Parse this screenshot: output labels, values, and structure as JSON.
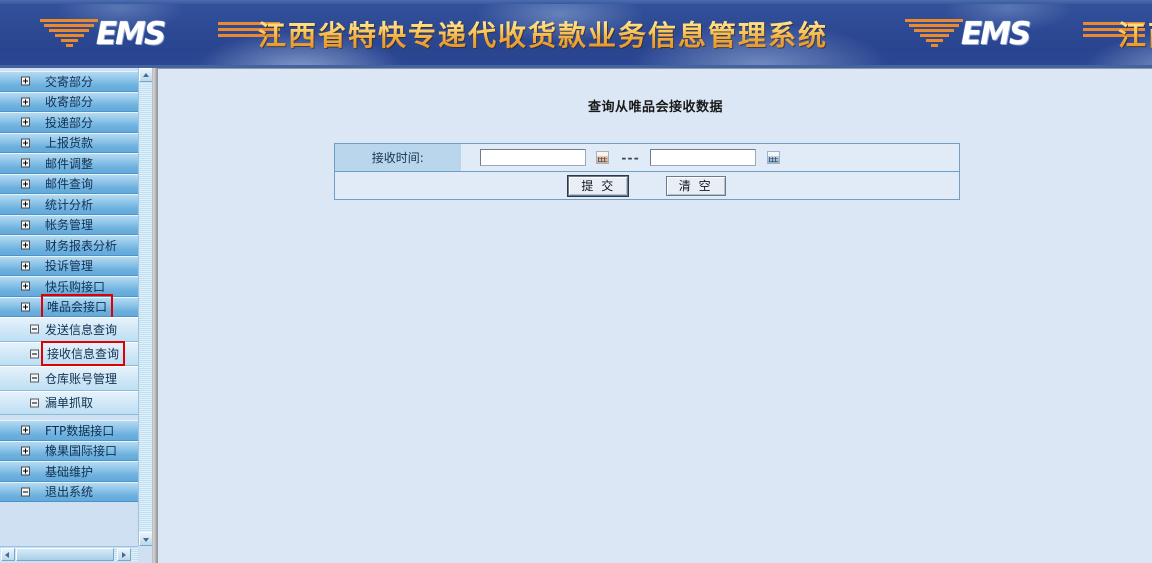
{
  "banner": {
    "logo_text": "EMS",
    "title": "江西省特快专递代收货款业务信息管理系统",
    "title_repeat": "江西",
    "bg_color": "#2c4b96",
    "title_color": "#ffd772",
    "logo_bar_color": "#e98a2e"
  },
  "sidebar": {
    "items": [
      {
        "label": "交寄部分",
        "type": "group",
        "icon": "plus-box-icon",
        "highlight": false
      },
      {
        "label": "收寄部分",
        "type": "group",
        "icon": "plus-box-icon",
        "highlight": false
      },
      {
        "label": "投递部分",
        "type": "group",
        "icon": "plus-box-icon",
        "highlight": false
      },
      {
        "label": "上报货款",
        "type": "group",
        "icon": "plus-box-icon",
        "highlight": false
      },
      {
        "label": "邮件调整",
        "type": "group",
        "icon": "plus-box-icon",
        "highlight": false
      },
      {
        "label": "邮件查询",
        "type": "group",
        "icon": "plus-box-icon",
        "highlight": false
      },
      {
        "label": "统计分析",
        "type": "group",
        "icon": "plus-box-icon",
        "highlight": false
      },
      {
        "label": "帐务管理",
        "type": "group",
        "icon": "plus-box-icon",
        "highlight": false
      },
      {
        "label": "财务报表分析",
        "type": "group",
        "icon": "plus-box-icon",
        "highlight": false
      },
      {
        "label": "投诉管理",
        "type": "group",
        "icon": "plus-box-icon",
        "highlight": false
      },
      {
        "label": "快乐购接口",
        "type": "group",
        "icon": "plus-box-icon",
        "highlight": false
      },
      {
        "label": "唯品会接口",
        "type": "group",
        "icon": "plus-box-icon",
        "highlight": true
      },
      {
        "label": "发送信息查询",
        "type": "child",
        "icon": "minus-box-icon",
        "highlight": false
      },
      {
        "label": "接收信息查询",
        "type": "child",
        "icon": "minus-box-icon",
        "highlight": true
      },
      {
        "label": "仓库账号管理",
        "type": "child",
        "icon": "minus-box-icon",
        "highlight": false
      },
      {
        "label": "漏单抓取",
        "type": "child",
        "icon": "minus-box-icon",
        "highlight": false
      },
      {
        "label": "FTP数据接口",
        "type": "group",
        "icon": "plus-box-icon",
        "highlight": false
      },
      {
        "label": "橡果国际接口",
        "type": "group",
        "icon": "plus-box-icon",
        "highlight": false
      },
      {
        "label": "基础维护",
        "type": "group",
        "icon": "plus-box-icon",
        "highlight": false
      },
      {
        "label": "退出系统",
        "type": "group",
        "icon": "minus-box-icon",
        "highlight": false
      }
    ],
    "highlight_color": "#e00000",
    "scrollbar": {
      "up_arrow": "▲",
      "down_arrow": "▼",
      "left_arrow": "◀",
      "right_arrow": "▶"
    }
  },
  "main": {
    "page_title": "查询从唯品会接收数据",
    "form": {
      "time_label": "接收时间:",
      "date_from_value": "",
      "date_from_placeholder": "",
      "date_to_value": "",
      "date_to_placeholder": "",
      "separator": "---",
      "calendar_icon_from": "calendar-icon",
      "calendar_icon_to": "calendar-icon",
      "submit_label": "提 交",
      "clear_label": "清 空"
    }
  }
}
